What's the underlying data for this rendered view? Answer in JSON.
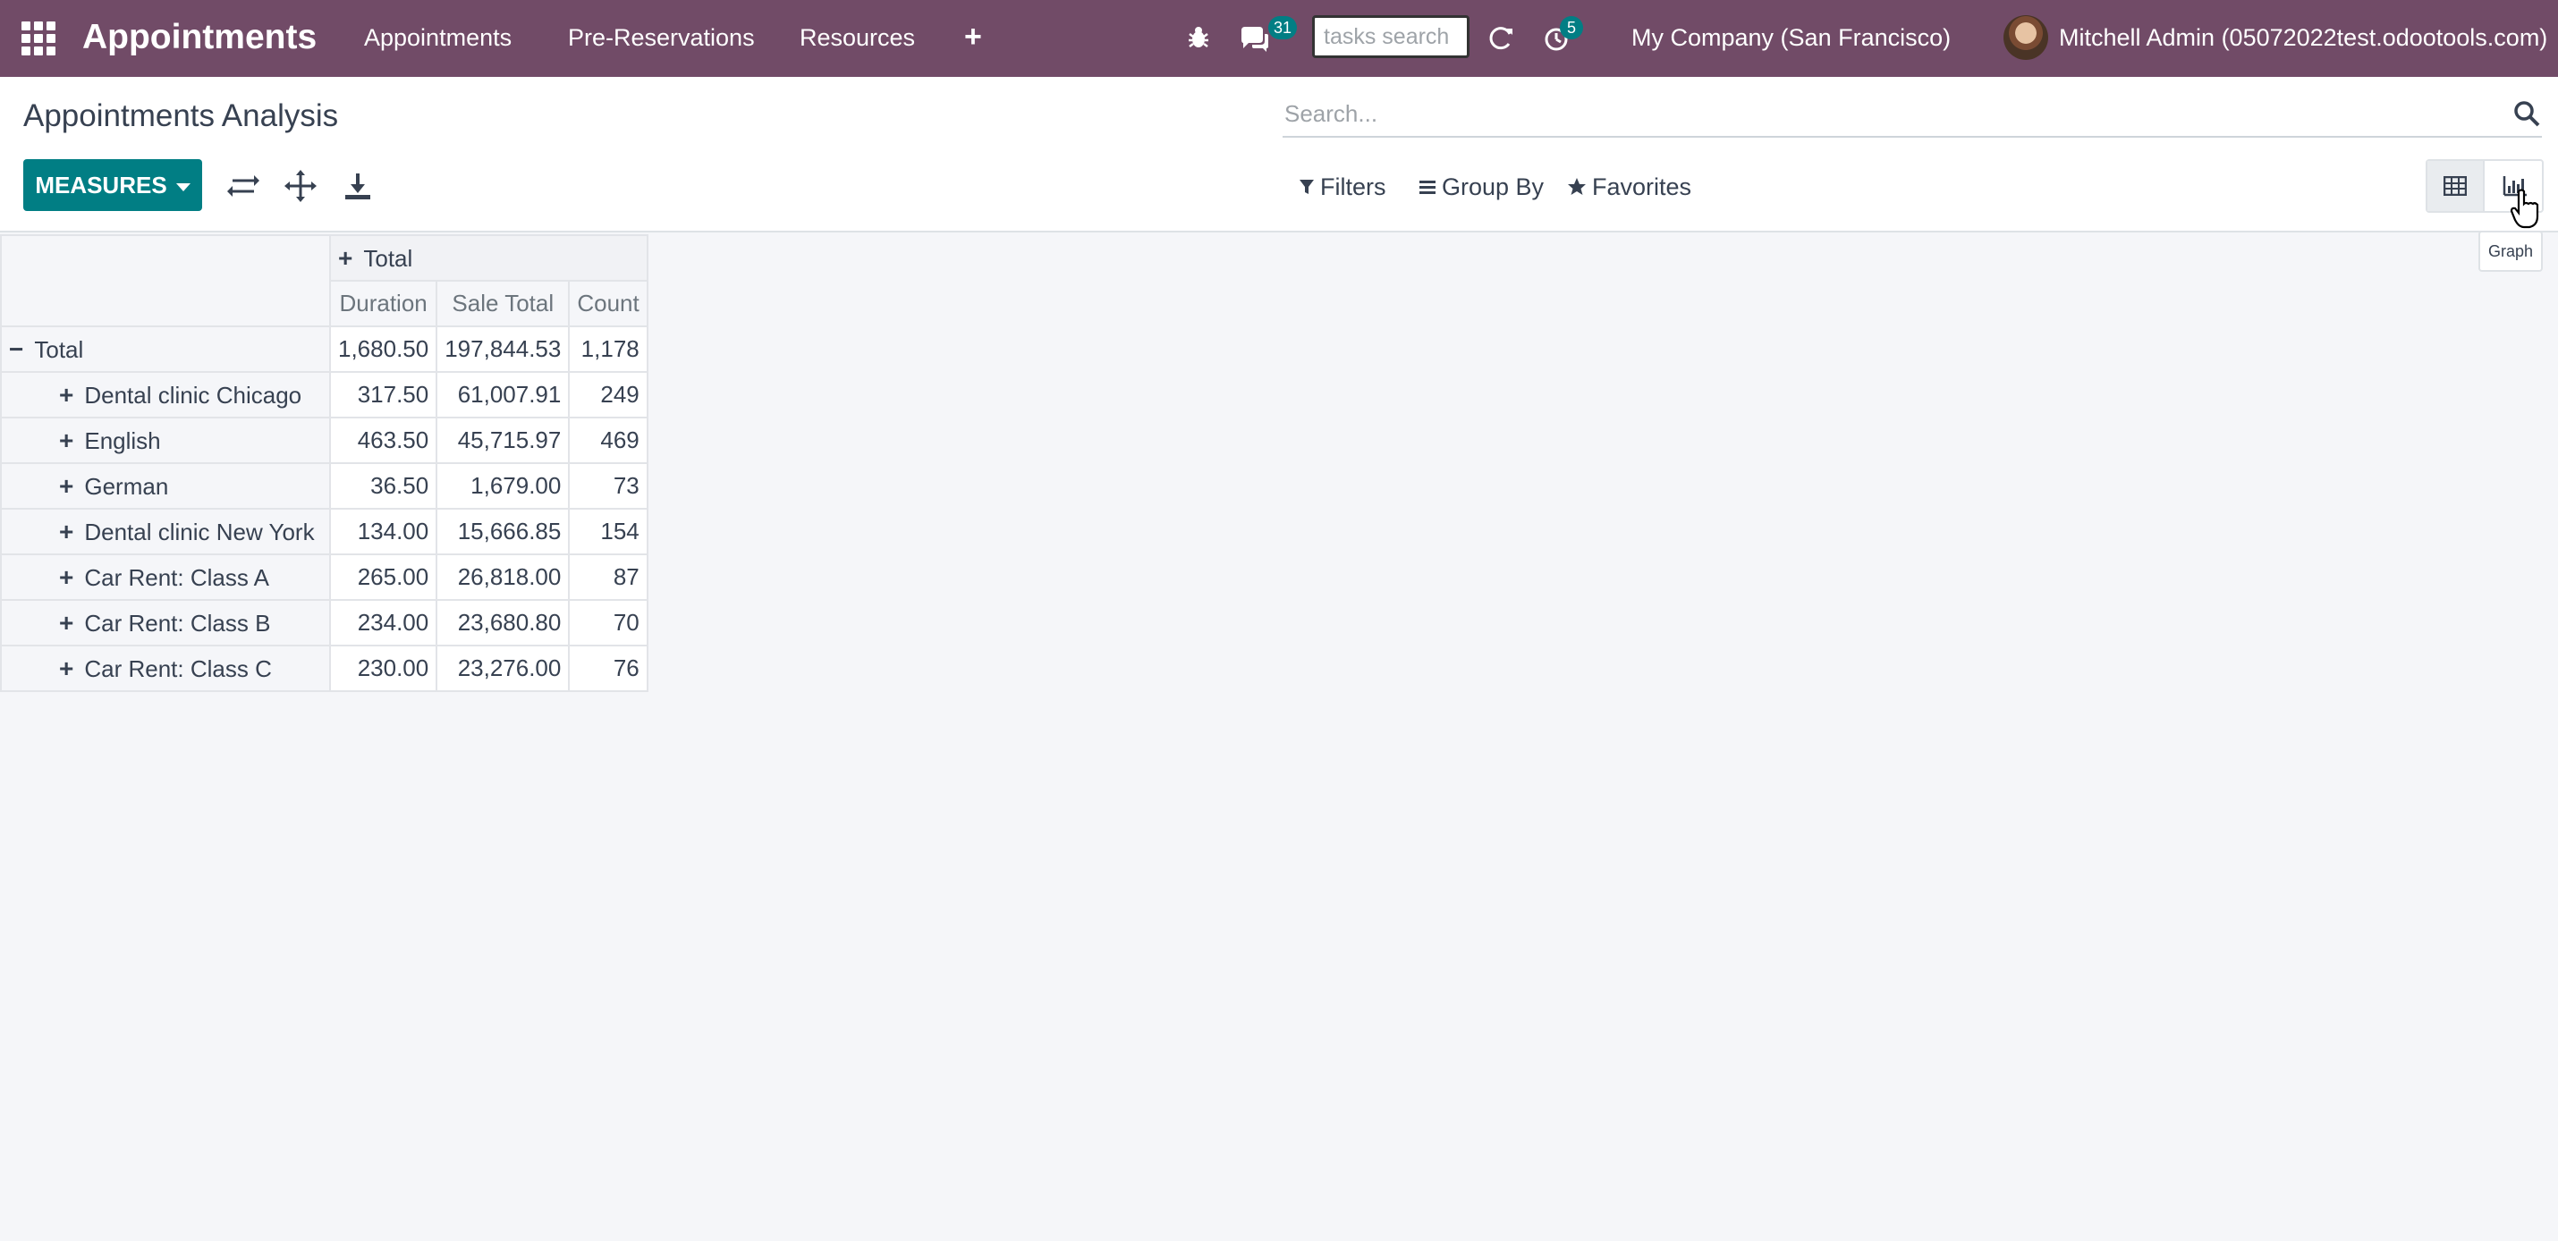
{
  "navbar": {
    "brand": "Appointments",
    "menu": [
      "Appointments",
      "Pre-Reservations",
      "Resources"
    ],
    "messages_badge": "31",
    "tasks_search_placeholder": "tasks search",
    "activities_badge": "5",
    "company": "My Company (San Francisco)",
    "user": "Mitchell Admin (05072022test.odootools.com)"
  },
  "control_panel": {
    "title": "Appointments Analysis",
    "search_placeholder": "Search...",
    "measures_label": "MEASURES",
    "filters_label": "Filters",
    "group_by_label": "Group By",
    "favorites_label": "Favorites",
    "tooltip": "Graph"
  },
  "pivot": {
    "col_header": "Total",
    "measures": [
      "Duration",
      "Sale Total",
      "Count"
    ],
    "total_row": {
      "label": "Total",
      "values": [
        "1,680.50",
        "197,844.53",
        "1,178"
      ]
    },
    "rows": [
      {
        "label": "Dental clinic Chicago",
        "values": [
          "317.50",
          "61,007.91",
          "249"
        ]
      },
      {
        "label": "English",
        "values": [
          "463.50",
          "45,715.97",
          "469"
        ]
      },
      {
        "label": "German",
        "values": [
          "36.50",
          "1,679.00",
          "73"
        ]
      },
      {
        "label": "Dental clinic New York",
        "values": [
          "134.00",
          "15,666.85",
          "154"
        ]
      },
      {
        "label": "Car Rent: Class A",
        "values": [
          "265.00",
          "26,818.00",
          "87"
        ]
      },
      {
        "label": "Car Rent: Class B",
        "values": [
          "234.00",
          "23,680.80",
          "70"
        ]
      },
      {
        "label": "Car Rent: Class C",
        "values": [
          "230.00",
          "23,276.00",
          "76"
        ]
      }
    ]
  }
}
